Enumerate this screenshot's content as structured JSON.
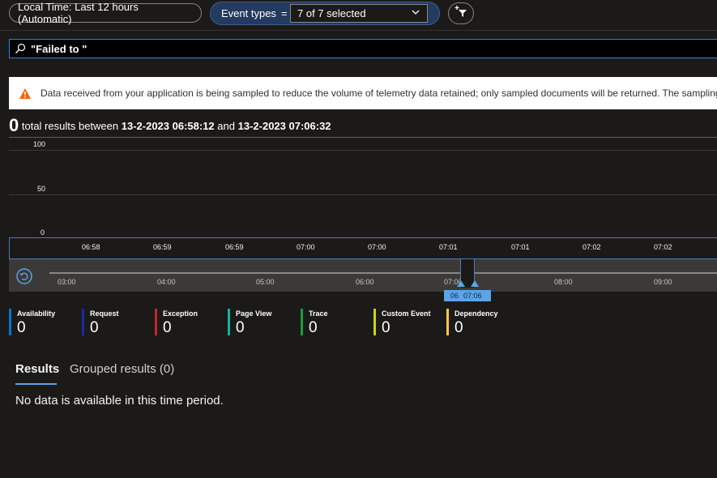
{
  "toolbar": {
    "time_range_label": "Local Time: Last 12 hours (Automatic)",
    "event_types_label": "Event types",
    "event_types_operator": "=",
    "event_types_value": "7 of 7 selected"
  },
  "search": {
    "value": "\"Failed to \""
  },
  "banner": {
    "text": "Data received from your application is being sampled to reduce the volume of telemetry data retained; only sampled documents will be returned. The sampling"
  },
  "summary": {
    "count": "0",
    "text_before": "total results between",
    "start": "13-2-2023 06:58:12",
    "and": "and",
    "end": "13-2-2023 07:06:32"
  },
  "chart": {
    "y_ticks": [
      "100",
      "50",
      "0"
    ],
    "x_ticks": [
      "06:58",
      "06:59",
      "06:59",
      "07:00",
      "07:00",
      "07:01",
      "07:01",
      "07:02",
      "07:02"
    ],
    "overview_ticks": [
      "03:00",
      "04:00",
      "05:00",
      "06:00",
      "07:00",
      "08:00",
      "09:00"
    ],
    "brush_start_label": "06",
    "brush_end_label": "07:06"
  },
  "legend": [
    {
      "name": "Availability",
      "value": "0",
      "color": "#0078d4"
    },
    {
      "name": "Request",
      "value": "0",
      "color": "#1a2aa6"
    },
    {
      "name": "Exception",
      "value": "0",
      "color": "#c4262e"
    },
    {
      "name": "Page View",
      "value": "0",
      "color": "#16b29d"
    },
    {
      "name": "Trace",
      "value": "0",
      "color": "#1a9e3b"
    },
    {
      "name": "Custom Event",
      "value": "0",
      "color": "#c9d317"
    },
    {
      "name": "Dependency",
      "value": "0",
      "color": "#ffc83d"
    }
  ],
  "tabs": {
    "results": "Results",
    "grouped": "Grouped results (0)"
  },
  "empty_message": "No data is available in this time period."
}
